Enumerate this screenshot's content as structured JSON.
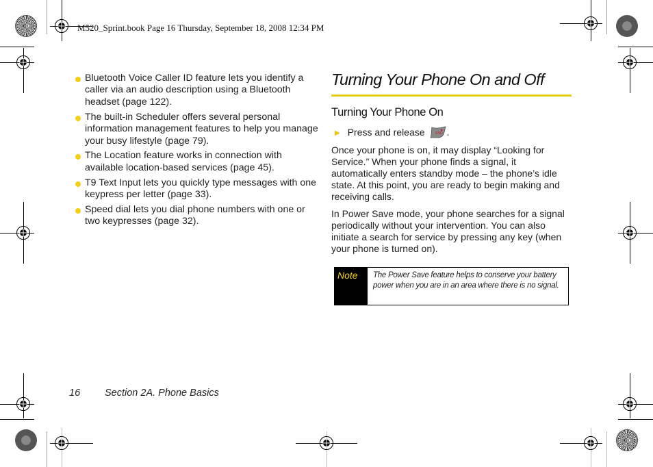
{
  "header": {
    "print_info": "M520_Sprint.book  Page 16  Thursday, September 18, 2008  12:34 PM"
  },
  "left_column": {
    "bullets": [
      "Bluetooth Voice Caller ID feature lets you identify a caller via an audio description using a Bluetooth headset (page 122).",
      "The built-in Scheduler offers several personal information management features to help you manage your busy lifestyle (page 79).",
      "The Location feature works in connection with available location-based services (page 45).",
      "T9 Text Input lets you quickly type messages with one keypress per letter (page 33).",
      "Speed dial lets you dial phone numbers with one or two keypresses (page 32)."
    ]
  },
  "right_column": {
    "title": "Turning Your Phone On and Off",
    "subtitle": "Turning Your Phone On",
    "step": {
      "text": "Press and release",
      "key_icon": "end-key-icon",
      "suffix": "."
    },
    "paragraphs": [
      "Once your phone is on, it may display “Looking for Service.” When your phone finds a signal, it automatically enters standby mode – the phone’s idle state. At this point, you are ready to begin making and receiving calls.",
      "In Power Save mode, your phone searches for a signal periodically without your intervention. You can also initiate a search for service by pressing any key (when your phone is turned on)."
    ],
    "note": {
      "label": "Note",
      "text": "The Power Save feature helps to conserve your battery power when you are in an area where there is no signal."
    }
  },
  "footer": {
    "page_number": "16",
    "section": "Section 2A. Phone Basics"
  },
  "colors": {
    "accent_yellow": "#e8cc1a",
    "note_bg": "#000000"
  }
}
